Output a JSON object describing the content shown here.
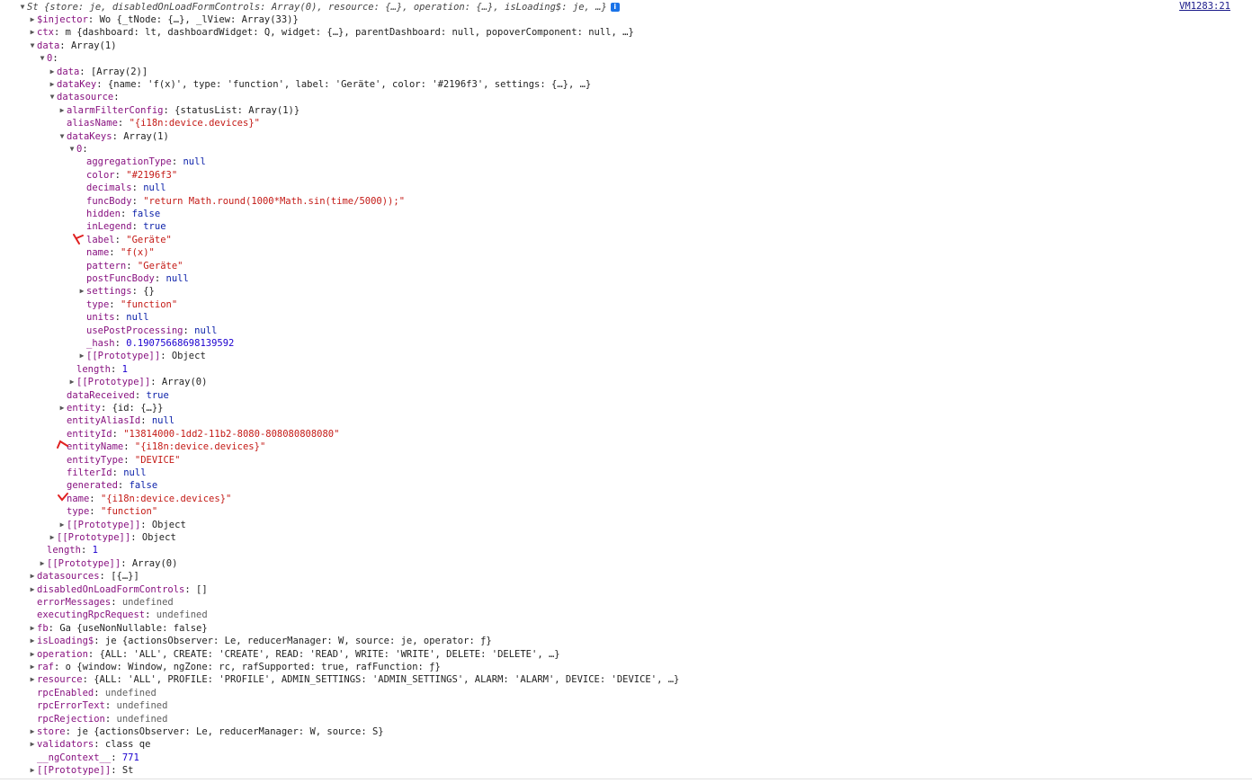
{
  "console": {
    "source_link": "VM1283:21",
    "rows": [
      {
        "d": 0,
        "t": "open",
        "k": "",
        "v": "St {store: je, disabledOnLoadFormControls: Array(0), resource: {…}, operation: {…}, isLoading$: je, …}",
        "vt": "plain",
        "header": true
      },
      {
        "d": 1,
        "t": "closed",
        "k": "$injector",
        "v": "Wo {_tNode: {…}, _lView: Array(33)}",
        "vt": "plain"
      },
      {
        "d": 1,
        "t": "closed",
        "k": "ctx",
        "v": "m {dashboard: lt, dashboardWidget: Q, widget: {…}, parentDashboard: null, popoverComponent: null, …}",
        "vt": "plain"
      },
      {
        "d": 1,
        "t": "open",
        "k": "data",
        "v": "Array(1)",
        "vt": "plain"
      },
      {
        "d": 2,
        "t": "open",
        "k": "0",
        "v": "",
        "vt": "plain"
      },
      {
        "d": 3,
        "t": "closed",
        "k": "data",
        "v": "[Array(2)]",
        "vt": "plain"
      },
      {
        "d": 3,
        "t": "closed",
        "k": "dataKey",
        "v": "{name: 'f(x)', type: 'function', label: 'Geräte', color: '#2196f3', settings: {…}, …}",
        "vt": "plain"
      },
      {
        "d": 3,
        "t": "open",
        "k": "datasource",
        "v": "",
        "vt": "plain"
      },
      {
        "d": 4,
        "t": "closed",
        "k": "alarmFilterConfig",
        "v": "{statusList: Array(1)}",
        "vt": "plain"
      },
      {
        "d": 4,
        "t": "none",
        "k": "aliasName",
        "v": "\"{i18n:device.devices}\"",
        "vt": "str"
      },
      {
        "d": 4,
        "t": "open",
        "k": "dataKeys",
        "v": "Array(1)",
        "vt": "plain"
      },
      {
        "d": 5,
        "t": "open",
        "k": "0",
        "v": "",
        "vt": "plain"
      },
      {
        "d": 6,
        "t": "none",
        "k": "aggregationType",
        "v": "null",
        "vt": "kw"
      },
      {
        "d": 6,
        "t": "none",
        "k": "color",
        "v": "\"#2196f3\"",
        "vt": "str"
      },
      {
        "d": 6,
        "t": "none",
        "k": "decimals",
        "v": "null",
        "vt": "kw"
      },
      {
        "d": 6,
        "t": "none",
        "k": "funcBody",
        "v": "\"return Math.round(1000*Math.sin(time/5000));\"",
        "vt": "str"
      },
      {
        "d": 6,
        "t": "none",
        "k": "hidden",
        "v": "false",
        "vt": "kw"
      },
      {
        "d": 6,
        "t": "none",
        "k": "inLegend",
        "v": "true",
        "vt": "kw"
      },
      {
        "d": 6,
        "t": "none",
        "k": "label",
        "v": "\"Geräte\"",
        "vt": "str"
      },
      {
        "d": 6,
        "t": "none",
        "k": "name",
        "v": "\"f(x)\"",
        "vt": "str"
      },
      {
        "d": 6,
        "t": "none",
        "k": "pattern",
        "v": "\"Geräte\"",
        "vt": "str"
      },
      {
        "d": 6,
        "t": "none",
        "k": "postFuncBody",
        "v": "null",
        "vt": "kw"
      },
      {
        "d": 6,
        "t": "closed",
        "k": "settings",
        "v": "{}",
        "vt": "plain"
      },
      {
        "d": 6,
        "t": "none",
        "k": "type",
        "v": "\"function\"",
        "vt": "str"
      },
      {
        "d": 6,
        "t": "none",
        "k": "units",
        "v": "null",
        "vt": "kw"
      },
      {
        "d": 6,
        "t": "none",
        "k": "usePostProcessing",
        "v": "null",
        "vt": "kw"
      },
      {
        "d": 6,
        "t": "none",
        "k": "_hash",
        "v": "0.19075668698139592",
        "vt": "num"
      },
      {
        "d": 6,
        "t": "closed",
        "k": "[[Prototype]]",
        "v": "Object",
        "vt": "plain"
      },
      {
        "d": 5,
        "t": "none",
        "k": "length",
        "v": "1",
        "vt": "num"
      },
      {
        "d": 5,
        "t": "closed",
        "k": "[[Prototype]]",
        "v": "Array(0)",
        "vt": "plain"
      },
      {
        "d": 4,
        "t": "none",
        "k": "dataReceived",
        "v": "true",
        "vt": "kw"
      },
      {
        "d": 4,
        "t": "closed",
        "k": "entity",
        "v": "{id: {…}}",
        "vt": "plain"
      },
      {
        "d": 4,
        "t": "none",
        "k": "entityAliasId",
        "v": "null",
        "vt": "kw"
      },
      {
        "d": 4,
        "t": "none",
        "k": "entityId",
        "v": "\"13814000-1dd2-11b2-8080-808080808080\"",
        "vt": "str"
      },
      {
        "d": 4,
        "t": "none",
        "k": "entityName",
        "v": "\"{i18n:device.devices}\"",
        "vt": "str"
      },
      {
        "d": 4,
        "t": "none",
        "k": "entityType",
        "v": "\"DEVICE\"",
        "vt": "str"
      },
      {
        "d": 4,
        "t": "none",
        "k": "filterId",
        "v": "null",
        "vt": "kw"
      },
      {
        "d": 4,
        "t": "none",
        "k": "generated",
        "v": "false",
        "vt": "kw"
      },
      {
        "d": 4,
        "t": "none",
        "k": "name",
        "v": "\"{i18n:device.devices}\"",
        "vt": "str"
      },
      {
        "d": 4,
        "t": "none",
        "k": "type",
        "v": "\"function\"",
        "vt": "str"
      },
      {
        "d": 4,
        "t": "closed",
        "k": "[[Prototype]]",
        "v": "Object",
        "vt": "plain"
      },
      {
        "d": 3,
        "t": "closed",
        "k": "[[Prototype]]",
        "v": "Object",
        "vt": "plain"
      },
      {
        "d": 2,
        "t": "none",
        "k": "length",
        "v": "1",
        "vt": "num"
      },
      {
        "d": 2,
        "t": "closed",
        "k": "[[Prototype]]",
        "v": "Array(0)",
        "vt": "plain"
      },
      {
        "d": 1,
        "t": "closed",
        "k": "datasources",
        "v": "[{…}]",
        "vt": "plain"
      },
      {
        "d": 1,
        "t": "closed",
        "k": "disabledOnLoadFormControls",
        "v": "[]",
        "vt": "plain"
      },
      {
        "d": 1,
        "t": "none",
        "k": "errorMessages",
        "v": "undefined",
        "vt": "undef"
      },
      {
        "d": 1,
        "t": "none",
        "k": "executingRpcRequest",
        "v": "undefined",
        "vt": "undef"
      },
      {
        "d": 1,
        "t": "closed",
        "k": "fb",
        "v": "Ga {useNonNullable: false}",
        "vt": "plain"
      },
      {
        "d": 1,
        "t": "closed",
        "k": "isLoading$",
        "v": "je {actionsObserver: Le, reducerManager: W, source: je, operator: ƒ}",
        "vt": "plain"
      },
      {
        "d": 1,
        "t": "closed",
        "k": "operation",
        "v": "{ALL: 'ALL', CREATE: 'CREATE', READ: 'READ', WRITE: 'WRITE', DELETE: 'DELETE', …}",
        "vt": "plain"
      },
      {
        "d": 1,
        "t": "closed",
        "k": "raf",
        "v": "o {window: Window, ngZone: rc, rafSupported: true, rafFunction: ƒ}",
        "vt": "plain"
      },
      {
        "d": 1,
        "t": "closed",
        "k": "resource",
        "v": "{ALL: 'ALL', PROFILE: 'PROFILE', ADMIN_SETTINGS: 'ADMIN_SETTINGS', ALARM: 'ALARM', DEVICE: 'DEVICE', …}",
        "vt": "plain"
      },
      {
        "d": 1,
        "t": "none",
        "k": "rpcEnabled",
        "v": "undefined",
        "vt": "undef"
      },
      {
        "d": 1,
        "t": "none",
        "k": "rpcErrorText",
        "v": "undefined",
        "vt": "undef"
      },
      {
        "d": 1,
        "t": "none",
        "k": "rpcRejection",
        "v": "undefined",
        "vt": "undef"
      },
      {
        "d": 1,
        "t": "closed",
        "k": "store",
        "v": "je {actionsObserver: Le, reducerManager: W, source: S}",
        "vt": "plain"
      },
      {
        "d": 1,
        "t": "closed",
        "k": "validators",
        "v": "class qe",
        "vt": "plain"
      },
      {
        "d": 1,
        "t": "none",
        "k": "__ngContext__",
        "v": "771",
        "vt": "num"
      },
      {
        "d": 1,
        "t": "closed",
        "k": "[[Prototype]]",
        "v": "St",
        "vt": "plain"
      }
    ]
  },
  "colors": {
    "annotation": "#e02020",
    "info_badge": "#1a73e8"
  },
  "icons": {
    "expanded": "triangle-down-icon",
    "collapsed": "triangle-right-icon",
    "info": "info-icon",
    "annotation": "red-check-mark-icon"
  }
}
